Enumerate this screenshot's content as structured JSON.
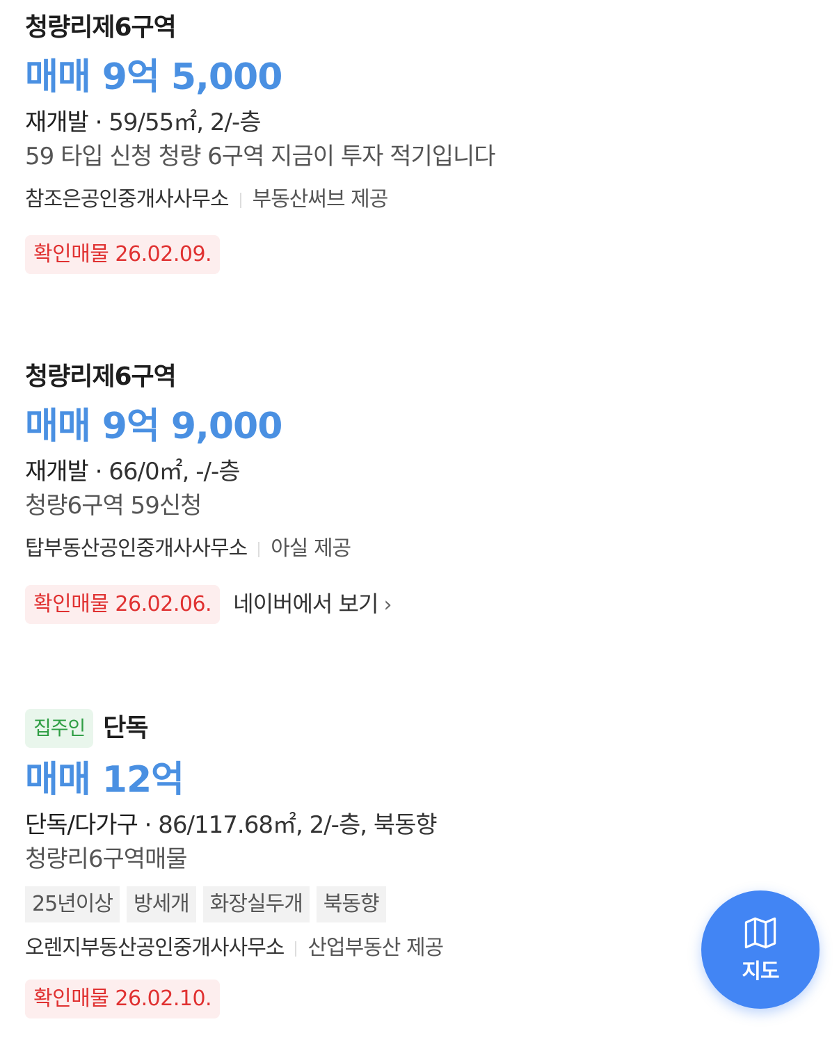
{
  "listings": [
    {
      "title": "청량리제6구역",
      "owner_badge": "",
      "price": "매매 9억 5,000",
      "type": "재개발",
      "dot": "·",
      "specs": "59/55㎡, 2/-층",
      "description": "59 타입 신청 청량 6구역 지금이 투자 적기입니다",
      "tags": [],
      "agency": "참조은공인중개사사무소",
      "provider": "부동산써브 제공",
      "confirm": "확인매물 26.02.09.",
      "link": ""
    },
    {
      "title": "청량리제6구역",
      "owner_badge": "",
      "price": "매매 9억 9,000",
      "type": "재개발",
      "dot": "·",
      "specs": "66/0㎡, -/-층",
      "description": "청량6구역 59신청",
      "tags": [],
      "agency": "탑부동산공인중개사사무소",
      "provider": "아실 제공",
      "confirm": "확인매물 26.02.06.",
      "link": "네이버에서 보기"
    },
    {
      "title": "단독",
      "owner_badge": "집주인",
      "price": "매매 12억",
      "type": "단독/다가구",
      "dot": "·",
      "specs": "86/117.68㎡, 2/-층, 북동향",
      "description": "청량리6구역매물",
      "tags": [
        "25년이상",
        "방세개",
        "화장실두개",
        "북동향"
      ],
      "agency": "오렌지부동산공인중개사사무소",
      "provider": "산업부동산 제공",
      "confirm": "확인매물 26.02.10.",
      "link": ""
    }
  ],
  "map_button": {
    "label": "지도",
    "icon": "map-icon"
  },
  "colors": {
    "price": "#4a90e2",
    "confirm_text": "#e03131",
    "confirm_bg": "#fdeeee",
    "owner_text": "#2f9e44",
    "owner_bg": "#e9f6ec",
    "fab": "#4285f4"
  }
}
